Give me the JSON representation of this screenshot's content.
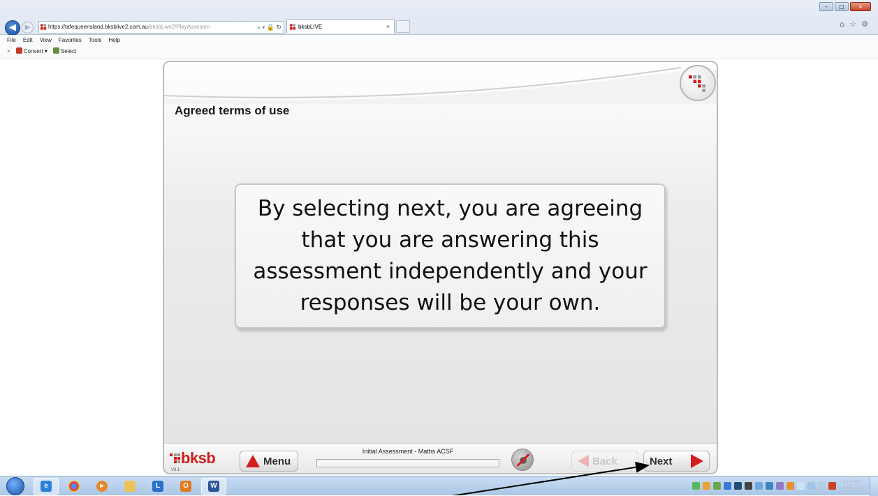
{
  "browser": {
    "url_host": "https://tafequeensland.bksblive2.com.au",
    "url_path": "/bksbLive2/PlayAssessm",
    "tab_title": "bksbLIVE",
    "menu": [
      "File",
      "Edit",
      "View",
      "Favorites",
      "Tools",
      "Help"
    ],
    "command_bar": {
      "close": "×",
      "convert_label": "Convert",
      "select_label": "Select"
    }
  },
  "player": {
    "section_title": "Agreed terms of use",
    "terms_text": "By selecting next, you are agreeing that you are answering this assessment independently and your responses will be your own.",
    "brand": "bksb",
    "version": "V3.1",
    "assessment_title": "Initial Assessment - Maths ACSF",
    "menu_button": "Menu",
    "back_button": "Back",
    "next_button": "Next"
  },
  "taskbar": {
    "apps": [
      "windows-start",
      "internet-explorer",
      "chrome",
      "media-player",
      "file-explorer",
      "lync",
      "outlook",
      "word"
    ],
    "clock_time": "3:45 PM",
    "clock_date": "2/03/2016"
  },
  "colors": {
    "brand_red": "#d51c1c",
    "accent_blue": "#1d55a6"
  }
}
